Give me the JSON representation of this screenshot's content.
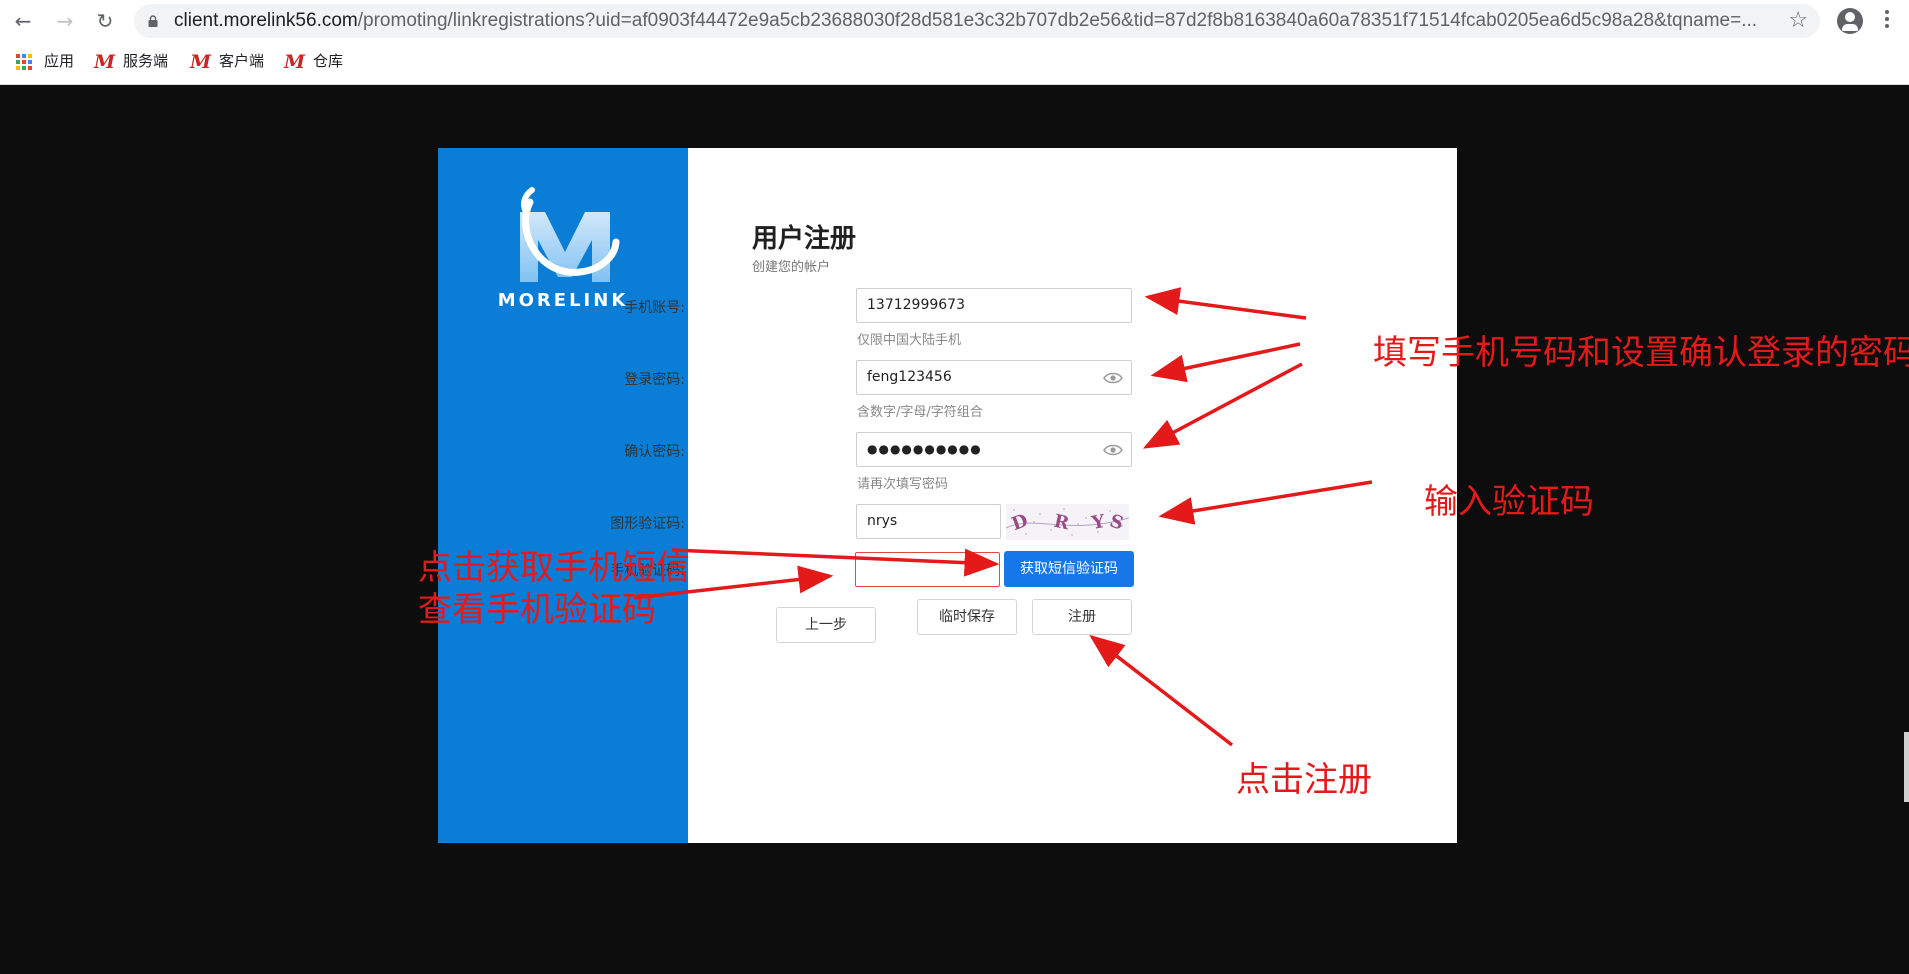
{
  "browser": {
    "url_host": "client.morelink56.com",
    "url_rest": "/promoting/linkregistrations?uid=af0903f44472e9a5cb23688030f28d581e3c32b707db2e56&tid=87d2f8b8163840a60a78351f71514fcab0205ea6d5c98a28&tqname=...",
    "bookmarks": [
      {
        "label": "应用",
        "icon": "apps-grid-icon"
      },
      {
        "label": "服务端",
        "icon": "morelink-m-icon"
      },
      {
        "label": "客户端",
        "icon": "morelink-m-icon"
      },
      {
        "label": "仓库",
        "icon": "morelink-m-icon"
      }
    ],
    "bookmark_m_glyph": "M"
  },
  "sidebar": {
    "brand": "MORELINK"
  },
  "form": {
    "title": "用户注册",
    "subtitle": "创建您的帐户",
    "phone": {
      "label": "手机账号:",
      "value": "13712999673",
      "hint": "仅限中国大陆手机"
    },
    "password": {
      "label": "登录密码:",
      "value": "feng123456",
      "hint": "含数字/字母/字符组合"
    },
    "confirm": {
      "label": "确认密码:",
      "value": "●●●●●●●●●●",
      "hint": "请再次填写密码"
    },
    "captcha": {
      "label": "图形验证码:",
      "value": "nrys",
      "image_chars": [
        "D",
        "R",
        "Y",
        "S"
      ]
    },
    "sms": {
      "label": "手机验证码:",
      "value": "",
      "button": "获取短信验证码"
    },
    "buttons": {
      "prev": "上一步",
      "save": "临时保存",
      "register": "注册"
    }
  },
  "annotations": {
    "fill_phone_password": "填写手机号码和设置确认登录的密码",
    "enter_captcha": "输入验证码",
    "sms_line1": "点击获取手机短信",
    "sms_line2": "查看手机验证码",
    "click_register": "点击注册"
  },
  "colors": {
    "sidebar": "#0a7ed6",
    "primary_button": "#1677e8",
    "annotation": "#e4191a",
    "backdrop": "#0d0d0d"
  }
}
